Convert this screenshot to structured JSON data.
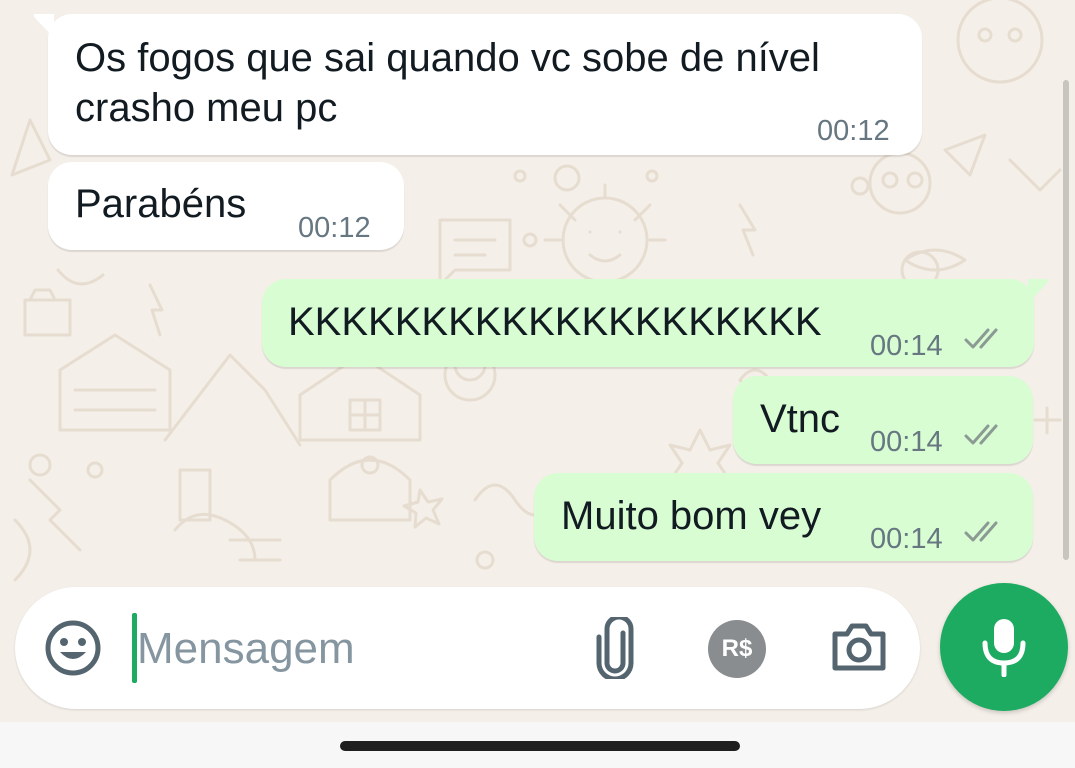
{
  "messages": [
    {
      "direction": "incoming",
      "text_line1": "Os fogos que sai quando vc sobe de nível",
      "text_line2": "crasho meu pc",
      "time": "00:12"
    },
    {
      "direction": "incoming",
      "text": "Parabéns",
      "time": "00:12"
    },
    {
      "direction": "outgoing",
      "text": "KKKKKKKKKKKKKKKKKKKK",
      "time": "00:14",
      "status": "delivered-double-check"
    },
    {
      "direction": "outgoing",
      "text": "Vtnc",
      "time": "00:14",
      "status": "delivered-double-check"
    },
    {
      "direction": "outgoing",
      "text": "Muito bom vey",
      "time": "00:14",
      "status": "delivered-double-check"
    }
  ],
  "composer": {
    "placeholder": "Mensagem",
    "emoji_icon": "emoji-icon",
    "attach_icon": "paperclip-icon",
    "payment_label": "R$",
    "camera_icon": "camera-icon",
    "mic_icon": "microphone-icon"
  },
  "colors": {
    "incoming_bubble": "#ffffff",
    "outgoing_bubble": "#d9fdd3",
    "accent": "#1daa61",
    "timestamp": "#667781",
    "chat_background": "#f4efe8"
  }
}
